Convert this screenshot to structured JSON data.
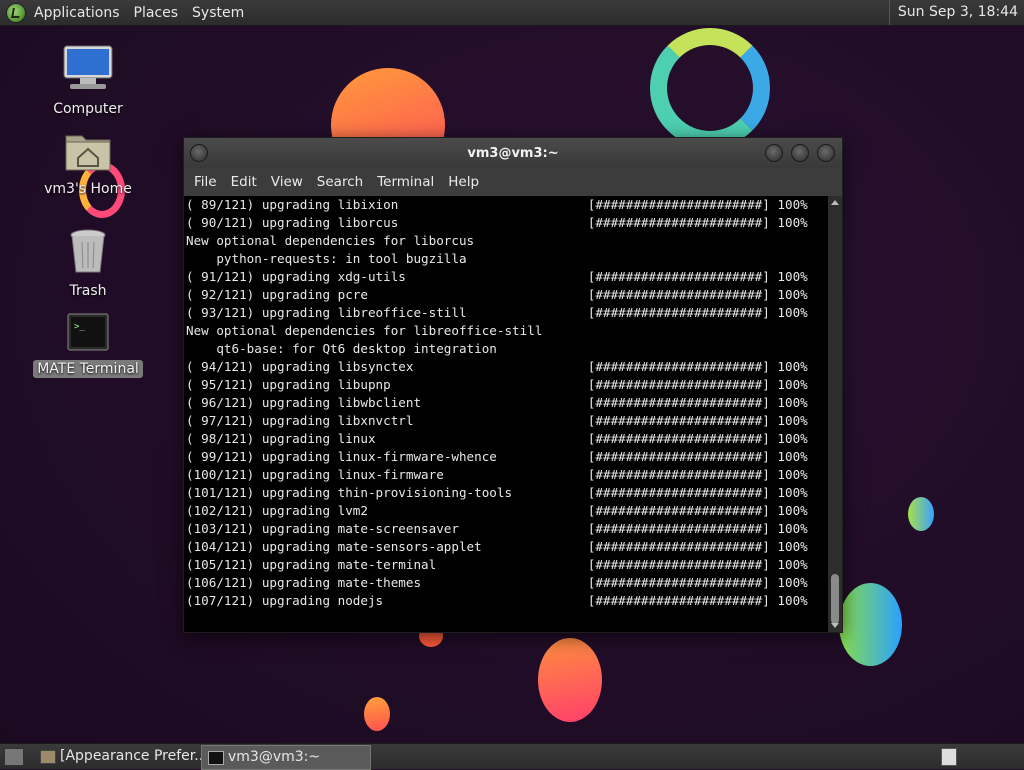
{
  "top_panel": {
    "menus": [
      "Applications",
      "Places",
      "System"
    ],
    "clock": "Sun Sep  3, 18:44",
    "logo_icon": "mate-logo-icon"
  },
  "desktop": {
    "icons": [
      {
        "label": "Computer",
        "icon": "computer-icon"
      },
      {
        "label": "vm3's Home",
        "icon": "home-folder-icon"
      },
      {
        "label": "Trash",
        "icon": "trash-icon"
      },
      {
        "label": "MATE Terminal",
        "icon": "terminal-icon",
        "selected": true
      }
    ]
  },
  "terminal": {
    "title": "vm3@vm3:~",
    "menu": [
      "File",
      "Edit",
      "View",
      "Search",
      "Terminal",
      "Help"
    ],
    "lines": [
      "( 89/121) upgrading libixion                         [######################] 100%",
      "( 90/121) upgrading liborcus                         [######################] 100%",
      "New optional dependencies for liborcus",
      "    python-requests: in tool bugzilla",
      "( 91/121) upgrading xdg-utils                        [######################] 100%",
      "( 92/121) upgrading pcre                             [######################] 100%",
      "( 93/121) upgrading libreoffice-still                [######################] 100%",
      "New optional dependencies for libreoffice-still",
      "    qt6-base: for Qt6 desktop integration",
      "( 94/121) upgrading libsynctex                       [######################] 100%",
      "( 95/121) upgrading libupnp                          [######################] 100%",
      "( 96/121) upgrading libwbclient                      [######################] 100%",
      "( 97/121) upgrading libxnvctrl                       [######################] 100%",
      "( 98/121) upgrading linux                            [######################] 100%",
      "( 99/121) upgrading linux-firmware-whence            [######################] 100%",
      "(100/121) upgrading linux-firmware                   [######################] 100%",
      "(101/121) upgrading thin-provisioning-tools          [######################] 100%",
      "(102/121) upgrading lvm2                             [######################] 100%",
      "(103/121) upgrading mate-screensaver                 [######################] 100%",
      "(104/121) upgrading mate-sensors-applet              [######################] 100%",
      "(105/121) upgrading mate-terminal                    [######################] 100%",
      "(106/121) upgrading mate-themes                      [######################] 100%",
      "(107/121) upgrading nodejs                           [######################] 100%"
    ]
  },
  "taskbar": {
    "tasks": [
      {
        "label": "[Appearance Prefer...",
        "icon": "appearance-icon",
        "active": false
      },
      {
        "label": "vm3@vm3:~",
        "icon": "terminal-icon",
        "active": true
      }
    ]
  },
  "colors": {
    "desktop_bg": "#24102a",
    "panel_bg": "#333333",
    "terminal_bg": "#000000",
    "terminal_fg": "#e8e8e8"
  }
}
